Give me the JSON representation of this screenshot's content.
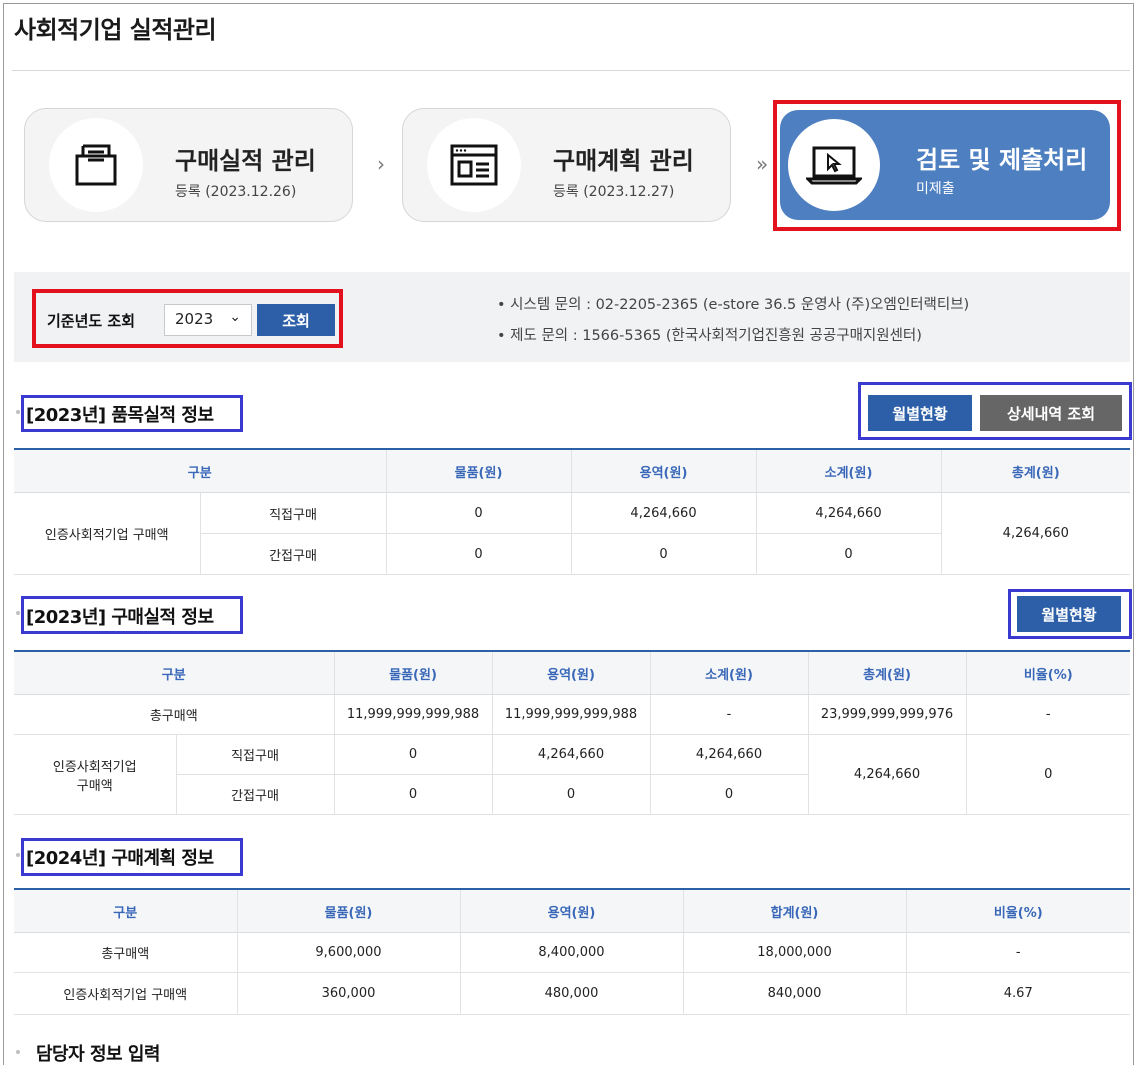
{
  "page": {
    "title": "사회적기업 실적관리"
  },
  "steps": [
    {
      "name": "구매실적 관리",
      "status": "등록 (2023.12.26)",
      "icon": "folder-icon"
    },
    {
      "name": "구매계획 관리",
      "status": "등록 (2023.12.27)",
      "icon": "browser-window-icon"
    },
    {
      "name": "검토 및 제출처리",
      "status": "미제출",
      "icon": "laptop-cursor-icon"
    }
  ],
  "step_arrows": [
    "›",
    "»"
  ],
  "filter": {
    "label": "기준년도 조회",
    "year": "2023",
    "search_button": "조회",
    "contacts": [
      "• 시스템 문의 : 02-2205-2365 (e-store 36.5 운영사 (주)오엠인터랙티브)",
      "• 제도 문의 : 1566-5365 (한국사회적기업진흥원 공공구매지원센터)"
    ]
  },
  "colors": {
    "accent": "#2c5fa8",
    "active_step": "#4d7fc1",
    "highlight_red": "#e3101e",
    "highlight_blue": "#3a3ad0"
  },
  "section1": {
    "title": "[2023년] 품목실적 정보",
    "btn_monthly": "월별현황",
    "btn_detail": "상세내역 조회",
    "headers": [
      "구분",
      "물품(원)",
      "용역(원)",
      "소계(원)",
      "총계(원)"
    ],
    "group_label": "인증사회적기업 구매액",
    "rows": [
      {
        "label": "직접구매",
        "goods": "0",
        "service": "4,264,660",
        "subtotal": "4,264,660"
      },
      {
        "label": "간접구매",
        "goods": "0",
        "service": "0",
        "subtotal": "0"
      }
    ],
    "total": "4,264,660"
  },
  "section2": {
    "title": "[2023년] 구매실적 정보",
    "btn_monthly": "월별현황",
    "headers": [
      "구분",
      "물품(원)",
      "용역(원)",
      "소계(원)",
      "총계(원)",
      "비율(%)"
    ],
    "total_row": {
      "label": "총구매액",
      "goods": "11,999,999,999,988",
      "service": "11,999,999,999,988",
      "subtotal": "-",
      "total": "23,999,999,999,976",
      "ratio": "-"
    },
    "group_label_line1": "인증사회적기업",
    "group_label_line2": "구매액",
    "rows": [
      {
        "label": "직접구매",
        "goods": "0",
        "service": "4,264,660",
        "subtotal": "4,264,660"
      },
      {
        "label": "간접구매",
        "goods": "0",
        "service": "0",
        "subtotal": "0"
      }
    ],
    "group_total": "4,264,660",
    "group_ratio": "0"
  },
  "section3": {
    "title": "[2024년] 구매계획 정보",
    "headers": [
      "구분",
      "물품(원)",
      "용역(원)",
      "합계(원)",
      "비율(%)"
    ],
    "rows": [
      {
        "label": "총구매액",
        "goods": "9,600,000",
        "service": "8,400,000",
        "total": "18,000,000",
        "ratio": "-"
      },
      {
        "label": "인증사회적기업 구매액",
        "goods": "360,000",
        "service": "480,000",
        "total": "840,000",
        "ratio": "4.67"
      }
    ]
  },
  "section4": {
    "title": "담당자 정보 입력"
  }
}
